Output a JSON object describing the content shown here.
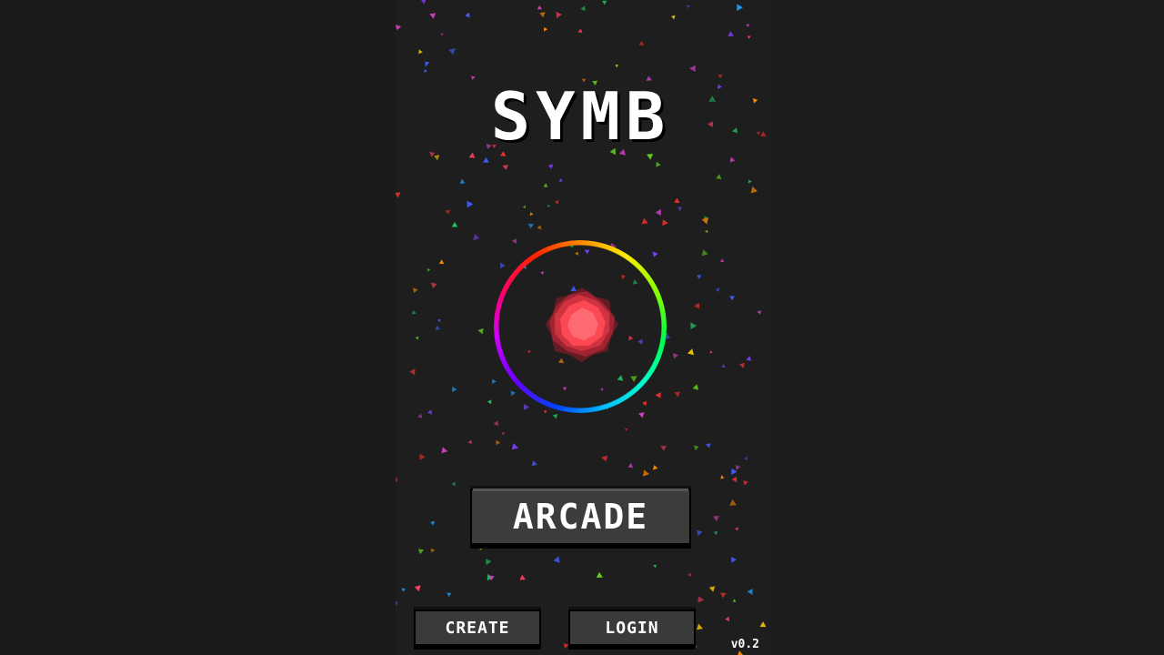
{
  "game": {
    "title": "SYMB",
    "buttons": {
      "arcade": "ARCADE",
      "create": "CREATE",
      "login": "LOGIN"
    },
    "version": "v0.2"
  },
  "colors": {
    "background": "#1e1e1e",
    "button": "#3a3a3a",
    "text": "#ffffff",
    "gem": "#ff4a55"
  },
  "icons": {
    "ring": "rainbow-ring-icon",
    "gem": "gem-icon"
  }
}
